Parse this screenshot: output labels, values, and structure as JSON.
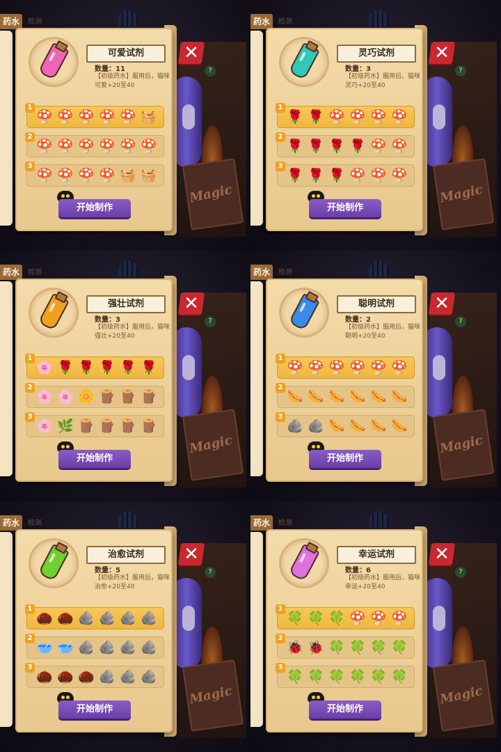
{
  "side_tab": {
    "label": "药水",
    "sub": "检测"
  },
  "bg_book": "Magic",
  "help_glyph": "?",
  "close_glyph": "✕",
  "start_button_label": "开始制作",
  "icon_glyphs": {
    "mushroom-purple": "🍄",
    "mushroom-pink": "🍄",
    "herb-box": "🧺",
    "rose": "🌹",
    "flower-white": "🌼",
    "lily": "🌸",
    "herb-bundle": "🌿",
    "wood-log": "🪵",
    "sausage": "🌭",
    "ore": "🪨",
    "nut": "🌰",
    "powder": "🥣",
    "clover": "🍀",
    "ladybug": "🐞"
  },
  "potions": [
    {
      "name": "可爱试剂",
      "qty": "数量：11",
      "desc": "【初级药水】服用后，猫咪可爱+20至40",
      "bottle_color": "#f064b4",
      "rows": [
        [
          "mushroom-purple",
          "mushroom-purple",
          "mushroom-purple",
          "mushroom-purple",
          "mushroom-purple",
          "herb-box"
        ],
        [
          "mushroom-purple",
          "mushroom-purple",
          "mushroom-purple",
          "mushroom-purple",
          "mushroom-purple",
          "mushroom-purple"
        ],
        [
          "mushroom-purple",
          "mushroom-purple",
          "mushroom-purple",
          "mushroom-purple",
          "herb-box",
          "herb-box"
        ]
      ]
    },
    {
      "name": "灵巧试剂",
      "qty": "数量：3",
      "desc": "【初级药水】服用后，猫咪灵巧+20至40",
      "bottle_color": "#30c8b8",
      "rows": [
        [
          "rose",
          "rose",
          "mushroom-purple",
          "mushroom-purple",
          "mushroom-purple",
          "mushroom-purple"
        ],
        [
          "rose",
          "rose",
          "rose",
          "rose",
          "mushroom-purple",
          "mushroom-purple"
        ],
        [
          "rose",
          "rose",
          "rose",
          "mushroom-purple",
          "mushroom-purple",
          "mushroom-purple"
        ]
      ]
    },
    {
      "name": "强壮试剂",
      "qty": "数量：3",
      "desc": "【初级药水】服用后，猫咪强壮+20至40",
      "bottle_color": "#f0a020",
      "rows": [
        [
          "lily",
          "rose",
          "rose",
          "rose",
          "rose",
          "rose"
        ],
        [
          "lily",
          "lily",
          "flower-white",
          "wood-log",
          "wood-log",
          "wood-log"
        ],
        [
          "lily",
          "herb-bundle",
          "wood-log",
          "wood-log",
          "wood-log",
          "wood-log"
        ]
      ]
    },
    {
      "name": "聪明试剂",
      "qty": "数量：2",
      "desc": "【初级药水】服用后，猫咪聪明+20至40",
      "bottle_color": "#3a8ae8",
      "rows": [
        [
          "mushroom-pink",
          "mushroom-pink",
          "mushroom-pink",
          "mushroom-purple",
          "mushroom-purple",
          "mushroom-purple"
        ],
        [
          "sausage",
          "sausage",
          "sausage",
          "sausage",
          "sausage",
          "sausage"
        ],
        [
          "ore",
          "ore",
          "sausage",
          "sausage",
          "sausage",
          "sausage"
        ]
      ]
    },
    {
      "name": "治愈试剂",
      "qty": "数量：5",
      "desc": "【初级药水】服用后，猫咪治愈+20至40",
      "bottle_color": "#70d030",
      "rows": [
        [
          "nut",
          "nut",
          "ore",
          "ore",
          "ore",
          "ore"
        ],
        [
          "powder",
          "powder",
          "ore",
          "ore",
          "ore",
          "ore"
        ],
        [
          "nut",
          "nut",
          "nut",
          "ore",
          "ore",
          "ore"
        ]
      ]
    },
    {
      "name": "幸运试剂",
      "qty": "数量：6",
      "desc": "【初级药水】服用后，猫咪幸运+20至40",
      "bottle_color": "#e070e0",
      "rows": [
        [
          "clover",
          "clover",
          "clover",
          "mushroom-pink",
          "mushroom-pink",
          "mushroom-pink"
        ],
        [
          "ladybug",
          "ladybug",
          "clover",
          "clover",
          "clover",
          "clover"
        ],
        [
          "clover",
          "clover",
          "clover",
          "clover",
          "clover",
          "clover"
        ]
      ]
    }
  ]
}
